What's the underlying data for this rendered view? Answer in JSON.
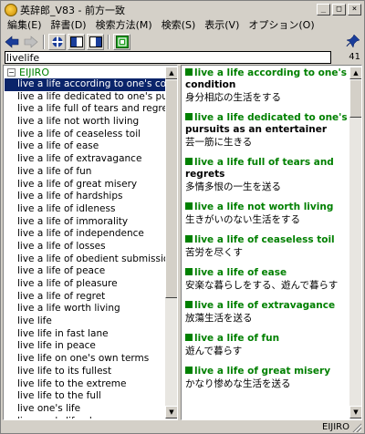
{
  "window": {
    "title": "英辞郎_V83 - 前方一致"
  },
  "title_buttons": {
    "minimize": "_",
    "maximize": "□",
    "close": "×"
  },
  "menu": [
    "編集(E)",
    "辞書(D)",
    "検索方法(M)",
    "検索(S)",
    "表示(V)",
    "オプション(O)"
  ],
  "search": {
    "value": "livelife",
    "count": "41"
  },
  "tree": {
    "root_label": "EIJIRO",
    "root_toggle": "−",
    "items": [
      "live a life according to one's condition",
      "live a life dedicated to one's pursuits as an entertainer",
      "live a life full of tears and regrets",
      "live a life not worth living",
      "live a life of ceaseless toil",
      "live a life of ease",
      "live a life of extravagance",
      "live a life of fun",
      "live a life of great misery",
      "live a life of hardships",
      "live a life of idleness",
      "live a life of immorality",
      "live a life of independence",
      "live a life of losses",
      "live a life of obedient submission",
      "live a life of peace",
      "live a life of pleasure",
      "live a life of regret",
      "live a life worth living",
      "live life",
      "live life in fast lane",
      "live life in peace",
      "live life on one's own terms",
      "live life to its fullest",
      "live life to the extreme",
      "live life to the full",
      "live one's life",
      "live one's life alone"
    ],
    "selected_index": 0
  },
  "entries": [
    {
      "head": "live a life according to one's",
      "cont": "condition",
      "jp": "身分相応の生活をする"
    },
    {
      "head": "live a life dedicated to one's",
      "cont": "pursuits as an entertainer",
      "jp": "芸一筋に生きる"
    },
    {
      "head": "live a life full of tears and",
      "cont": "regrets",
      "jp": "多情多恨の一生を送る"
    },
    {
      "head": "live a life not worth living",
      "cont": "",
      "jp": "生きがいのない生活をする"
    },
    {
      "head": "live a life of ceaseless toil",
      "cont": "",
      "jp": "苦労を尽くす"
    },
    {
      "head": "live a life of ease",
      "cont": "",
      "jp": "安楽な暮らしをする、遊んで暮らす"
    },
    {
      "head": "live a life of extravagance",
      "cont": "",
      "jp": "放蕩生活を送る"
    },
    {
      "head": "live a life of fun",
      "cont": "",
      "jp": "遊んで暮らす"
    },
    {
      "head": "live a life of great misery",
      "cont": "",
      "jp": "かなり惨めな生活を送る"
    }
  ],
  "status": {
    "dict": "EIJIRO"
  },
  "colors": {
    "selection": "#0a246a",
    "headword": "#008000",
    "chrome": "#d4d0c8"
  },
  "icons": [
    "back-arrow-icon",
    "forward-arrow-icon",
    "target-icon",
    "left-pane-view-icon",
    "right-pane-view-icon",
    "green-dictionary-icon",
    "pin-icon"
  ]
}
